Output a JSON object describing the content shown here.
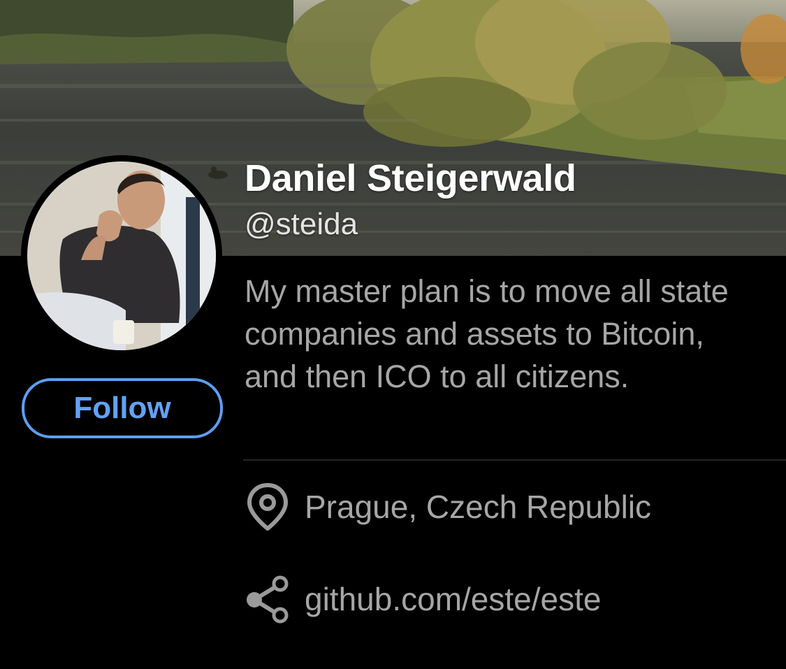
{
  "profile": {
    "display_name": "Daniel Steigerwald",
    "handle": "@steida",
    "bio": "My master plan is to move all state companies and assets to Bitcoin, and then ICO to all citizens.",
    "follow_label": "Follow",
    "location": "Prague, Czech Republic",
    "website": "github.com/este/este"
  },
  "icons": {
    "location": "map-pin-icon",
    "website": "share-icon"
  },
  "colors": {
    "background": "#000000",
    "accent": "#5d9ef2",
    "secondary_text": "#a6a6a6",
    "name_text": "#ffffff"
  }
}
